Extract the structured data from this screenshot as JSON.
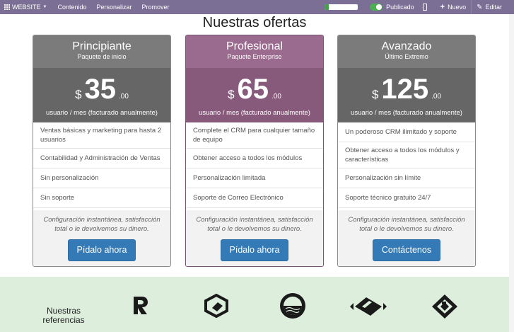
{
  "topbar": {
    "website_label": "WEBSITE",
    "menu": [
      "Contenido",
      "Personalizar",
      "Promover"
    ],
    "progress": 0.12,
    "published_label": "Publicado",
    "new_label": "Nuevo",
    "edit_label": "Editar"
  },
  "section_title": "Nuestras ofertas",
  "plans": [
    {
      "name": "Principiante",
      "subtitle": "Paquete de inicio",
      "currency": "$",
      "amount": "35",
      "decimals": ".00",
      "period": "usuario / mes (facturado anualmente)",
      "features": [
        "Ventas básicas y marketing para hasta 2 usuarios",
        "Contabilidad y Administración de Ventas",
        "Sin personalización",
        "Sin soporte"
      ],
      "note": "Configuración instantánea, satisfacción total o le devolvemos su dinero.",
      "button": "Pídalo ahora"
    },
    {
      "name": "Profesional",
      "subtitle": "Paquete Enterprise",
      "currency": "$",
      "amount": "65",
      "decimals": ".00",
      "period": "usuario / mes (facturado anualmente)",
      "features": [
        "Complete el CRM para cualquier tamaño de equipo",
        "Obtener acceso a todos los módulos",
        "Personalización limitada",
        "Soporte de Correo Electrónico"
      ],
      "note": "Configuración instantánea, satisfacción total o le devolvemos su dinero.",
      "button": "Pídalo ahora"
    },
    {
      "name": "Avanzado",
      "subtitle": "Último Extremo",
      "currency": "$",
      "amount": "125",
      "decimals": ".00",
      "period": "usuario / mes (facturado anualmente)",
      "features": [
        "Un poderoso CRM ilimitado y soporte",
        "Obtener acceso a todos los módulos y características",
        "Personalización sin límite",
        "Soporte técnico gratuito 24/7"
      ],
      "note": "Configuración instantánea, satisfacción total o le devolvemos su dinero.",
      "button": "Contáctenos"
    }
  ],
  "references": {
    "label": "Nuestras referencias",
    "logos": [
      "r-logo-icon",
      "hexagon-logo-icon",
      "circle-wave-logo-icon",
      "diamond-arrows-logo-icon",
      "diamond-square-logo-icon"
    ]
  },
  "colors": {
    "topbar": "#7b6f95",
    "featured": "#875a7b",
    "button": "#337ab7",
    "references_bg": "#ddeedd"
  }
}
